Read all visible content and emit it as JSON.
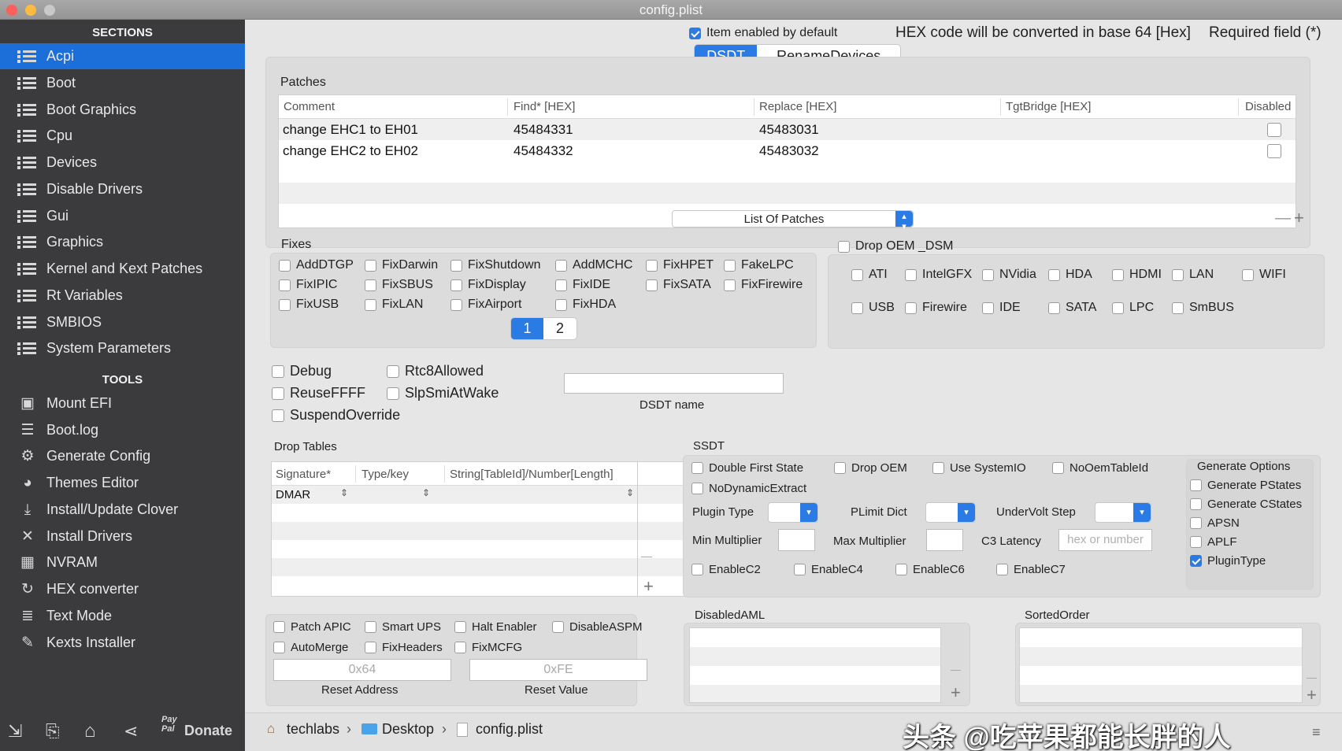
{
  "window": {
    "title": "config.plist"
  },
  "sidebar": {
    "sections_header": "SECTIONS",
    "sections": [
      {
        "label": "Acpi",
        "selected": true
      },
      {
        "label": "Boot"
      },
      {
        "label": "Boot Graphics"
      },
      {
        "label": "Cpu"
      },
      {
        "label": "Devices"
      },
      {
        "label": "Disable Drivers"
      },
      {
        "label": "Gui"
      },
      {
        "label": "Graphics"
      },
      {
        "label": "Kernel and Kext Patches"
      },
      {
        "label": "Rt Variables"
      },
      {
        "label": "SMBIOS"
      },
      {
        "label": "System Parameters"
      }
    ],
    "tools_header": "TOOLS",
    "tools": [
      {
        "label": "Mount EFI",
        "icon": "disk-icon"
      },
      {
        "label": "Boot.log",
        "icon": "log-icon"
      },
      {
        "label": "Generate Config",
        "icon": "gears-icon"
      },
      {
        "label": "Themes Editor",
        "icon": "palette-icon"
      },
      {
        "label": "Install/Update Clover",
        "icon": "download-icon"
      },
      {
        "label": "Install Drivers",
        "icon": "tools-icon"
      },
      {
        "label": "NVRAM",
        "icon": "chip-icon"
      },
      {
        "label": "HEX converter",
        "icon": "refresh-icon"
      },
      {
        "label": "Text Mode",
        "icon": "text-icon"
      },
      {
        "label": "Kexts Installer",
        "icon": "brush-icon"
      }
    ],
    "bottom": {
      "paypal_line1": "Pay",
      "paypal_line2": "Pal",
      "donate": "Donate"
    }
  },
  "header": {
    "item_enabled": "Item enabled by default",
    "hex_note": "HEX code will be converted in base 64 [Hex]",
    "required_note": "Required field (*)",
    "tabs": [
      {
        "label": "DSDT",
        "selected": true
      },
      {
        "label": "RenameDevices"
      }
    ]
  },
  "patches": {
    "title": "Patches",
    "columns": [
      "Comment",
      "Find* [HEX]",
      "Replace [HEX]",
      "TgtBridge [HEX]",
      "Disabled"
    ],
    "rows": [
      {
        "comment": "change EHC1 to EH01",
        "find": "45484331",
        "replace": "45483031",
        "tgt": ""
      },
      {
        "comment": "change EHC2 to EH02",
        "find": "45484332",
        "replace": "45483032",
        "tgt": ""
      }
    ],
    "list_popup": "List Of Patches"
  },
  "fixes": {
    "title": "Fixes",
    "items": [
      "AddDTGP",
      "FixDarwin",
      "FixShutdown",
      "AddMCHC",
      "FixHPET",
      "FakeLPC",
      "FixIPIC",
      "FixSBUS",
      "FixDisplay",
      "FixIDE",
      "FixSATA",
      "FixFirewire",
      "FixUSB",
      "FixLAN",
      "FixAirport",
      "FixHDA"
    ],
    "pages": [
      "1",
      "2"
    ]
  },
  "dsm": {
    "drop_label": "Drop OEM _DSM",
    "items": [
      "ATI",
      "IntelGFX",
      "NVidia",
      "HDA",
      "HDMI",
      "LAN",
      "WIFI",
      "USB",
      "Firewire",
      "IDE",
      "SATA",
      "LPC",
      "SmBUS"
    ]
  },
  "options": {
    "items": [
      "Debug",
      "Rtc8Allowed",
      "ReuseFFFF",
      "SlpSmiAtWake",
      "SuspendOverride"
    ],
    "dsdt_name_label": "DSDT name",
    "dsdt_name_value": ""
  },
  "drop_tables": {
    "title": "Drop Tables",
    "columns": [
      "Signature*",
      "Type/key",
      "String[TableId]/Number[Length]"
    ],
    "rows": [
      {
        "signature": "DMAR",
        "type": "",
        "string": ""
      }
    ]
  },
  "misc": {
    "items": [
      "Patch APIC",
      "Smart UPS",
      "Halt Enabler",
      "DisableASPM",
      "AutoMerge",
      "FixHeaders",
      "FixMCFG"
    ],
    "reset_address_placeholder": "0x64",
    "reset_address_label": "Reset Address",
    "reset_value_placeholder": "0xFE",
    "reset_value_label": "Reset Value"
  },
  "ssdt": {
    "title": "SSDT",
    "checks": [
      "Double First State",
      "Drop OEM",
      "Use SystemIO",
      "NoOemTableId",
      "NoDynamicExtract"
    ],
    "plugin_type": "Plugin Type",
    "plimit_dict": "PLimit Dict",
    "undervolt_step": "UnderVolt Step",
    "min_multiplier": "Min Multiplier",
    "max_multiplier": "Max Multiplier",
    "c3_latency": "C3 Latency",
    "c3_placeholder": "hex or number",
    "enable_checks": [
      "EnableC2",
      "EnableC4",
      "EnableC6",
      "EnableC7"
    ],
    "generate_options": {
      "title": "Generate Options",
      "items": [
        {
          "label": "Generate PStates",
          "checked": false
        },
        {
          "label": "Generate CStates",
          "checked": false
        },
        {
          "label": "APSN",
          "checked": false
        },
        {
          "label": "APLF",
          "checked": false
        },
        {
          "label": "PluginType",
          "checked": true
        }
      ]
    }
  },
  "disabled_aml": {
    "title": "DisabledAML"
  },
  "sorted_order": {
    "title": "SortedOrder"
  },
  "footer": {
    "path": [
      "techlabs",
      "Desktop",
      "config.plist"
    ],
    "watermark": "头条 @吃苹果都能长胖的人"
  },
  "colors": {
    "accent": "#1c6fd9",
    "sidebar_bg": "#3b3b3d"
  }
}
